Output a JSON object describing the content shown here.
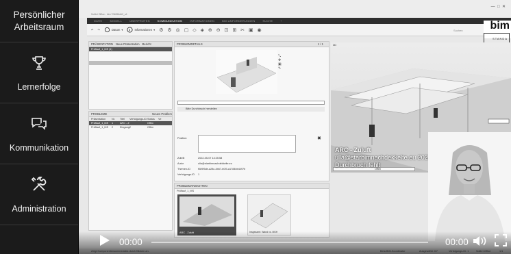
{
  "sidebar": {
    "items": [
      {
        "label_line1": "Persönlicher",
        "label_line2": "Arbeitsraum",
        "icon": "workspace"
      },
      {
        "label": "Lernerfolge",
        "icon": "trophy-icon"
      },
      {
        "label": "Kommunikation",
        "icon": "chat-bubbles-icon"
      },
      {
        "label": "Administration",
        "icon": "tools-icon"
      }
    ]
  },
  "app": {
    "window_title": "Solibri Office - bim 704896d#2_u1",
    "menu": [
      "DATEI",
      "MODELL",
      "ÜBERPRÜFEN",
      "KOMMUNIKATION",
      "INFORMATIONEN",
      "BIM ANFORDERUNGEN",
      "SUCHE",
      "+"
    ],
    "active_menu": "KOMMUNIKATION",
    "toolbar": {
      "items": [
        "Datum",
        "Informationen"
      ],
      "search_label": "Suchen"
    },
    "logo": {
      "text": "bim",
      "sub": "STANDA"
    },
    "presentation_panel": {
      "title": "PRÄSENTATION",
      "actions": [
        "Neue Präsentation",
        "Bericht"
      ],
      "selected_item": "Prüflauf_1_MS (1)"
    },
    "problem_panel": {
      "title": "PROBLEME",
      "action": "Neues Problem",
      "columns": [
        "Präsentation",
        "Nr.",
        "Titel",
        "Verfolgungs-ID",
        "Status",
        "Ve"
      ],
      "rows": [
        {
          "cells": [
            "Prüflauf_1_MS",
            "1",
            "ARC - Z",
            "",
            "Offen"
          ],
          "selected": true
        },
        {
          "cells": [
            "Prüflauf_1_MS",
            "2",
            "Eingang2",
            "",
            "Offen"
          ],
          "selected": false
        }
      ]
    },
    "details_panel": {
      "title": "PROBLEMDETAILS",
      "nav": "1 / 1",
      "description": "Bitte Durchbruch herstellen",
      "position_label": "Position",
      "fields": [
        {
          "label": "Zuteilt",
          "value": "2022-05-07 14:25:58"
        },
        {
          "label": "Autor",
          "value": "ulla@starbimnachdekkelte.eu"
        },
        {
          "label": "Themen-ID",
          "value": "f089f5de-a28c-4b67-b0f3-a1784bb4497b"
        },
        {
          "label": "Verfolgungs-ID",
          "value": "1"
        }
      ]
    },
    "snapshots_panel": {
      "title": "PROBLEMANSICHTEN",
      "subtitle": "Prüflauf_1_MS",
      "captions": [
        "ARC - Zuluft",
        "Insgesamt: Wand vs. MSH"
      ]
    },
    "view3d": {
      "title": "3D",
      "overlay_line1": "ARC - Zuluft",
      "overlay_line2": "ulla@starbimnachdekkelte.eu 2022-05-07",
      "overlay_line3": "Durchbruch fehlt",
      "bottom_filter": "Offen"
    },
    "statusbar": {
      "left": "Zeigt Komponentensumme/alles durch Klicken an.",
      "right": [
        "Beta BIM-Koordinator",
        "Ausgewählt: 0/7",
        "Verfolgungs-ID: 1",
        "Solibri Office",
        "1/1"
      ]
    }
  },
  "player": {
    "current_time": "00:00",
    "duration": "00:00",
    "progress": 0
  }
}
